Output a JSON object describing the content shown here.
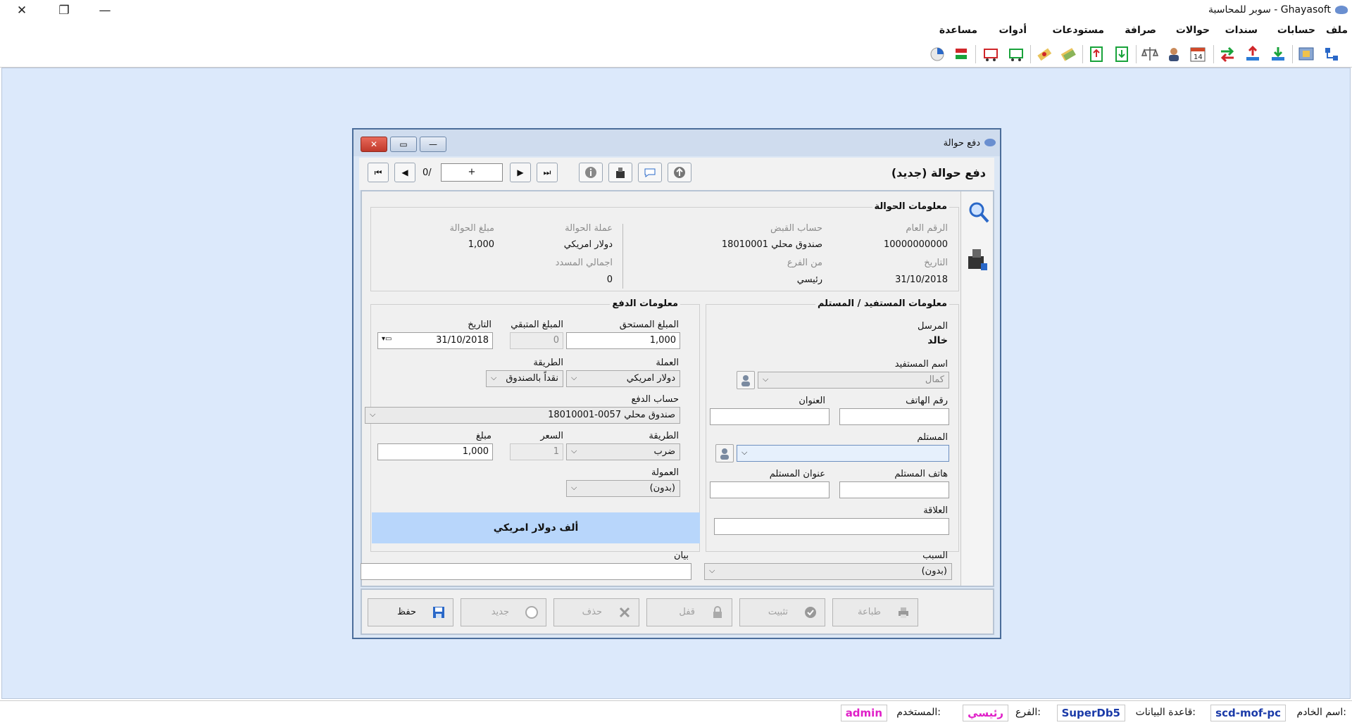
{
  "app": {
    "title": "سوبر للمحاسبة - Ghayasoft"
  },
  "titlebar": {
    "close": "✕",
    "restore": "❐",
    "minimize": "—"
  },
  "menu": [
    "ملف",
    "حسابات",
    "سندات",
    "حوالات",
    "صرافة",
    "مستودعات",
    "أدوات",
    "مساعدة"
  ],
  "status": {
    "server_label": "اسم الخادم:",
    "server": "scd-mof-pc",
    "db_label": "قاعدة البيانات:",
    "db": "SuperDb5",
    "branch_label": "الفرع:",
    "branch": "رئيسي",
    "user_label": "المستخدم:",
    "user": "admin"
  },
  "window": {
    "title": "دفع حوالة",
    "header": "دفع حوالة (جديد)",
    "close": "✕",
    "restore": "▭",
    "minimize": "—"
  },
  "nav": {
    "first": "⏮",
    "prev": "◀",
    "record": "+",
    "count": "0/",
    "next": "▶",
    "last": "⏭"
  },
  "transfer": {
    "group": "معلومات الحوالة",
    "general_no_label": "الرقم العام",
    "general_no": "10000000000",
    "date_label": "التاريخ",
    "date": "31/10/2018",
    "receipt_acc_label": "حساب القبض",
    "receipt_acc": "18010001 صندوق محلي",
    "from_branch_label": "من الفرع",
    "from_branch": "رئيسي",
    "currency_label": "عملة الحوالة",
    "currency": "دولار امريكي",
    "amount_label": "مبلغ الحوالة",
    "amount": "1,000",
    "paid_total_label": "اجمالي المسدد",
    "paid_total": "0"
  },
  "beneficiary": {
    "group": "معلومات المستفيد / المستلم",
    "sender_label": "المرسل",
    "sender": "خالد",
    "name_label": "اسم المستفيد",
    "name": "كمال",
    "phone_label": "رقم الهاتف",
    "address_label": "العنوان",
    "receiver_label": "المستلم",
    "receiver_phone_label": "هاتف المستلم",
    "receiver_address_label": "عنوان المستلم",
    "relation_label": "العلاقة"
  },
  "payment": {
    "group": "معلومات الدفع",
    "due_label": "المبلغ المستحق",
    "due": "1,000",
    "remaining_label": "المبلغ المتبقي",
    "remaining": "0",
    "date_label": "التاريخ",
    "date": "31/10/2018",
    "currency_label": "العملة",
    "currency": "دولار امريكي",
    "method_label": "الطريقة",
    "method": "نقداً بالصندوق",
    "account_label": "حساب الدفع",
    "account": "18010001-0057 صندوق محلي",
    "op_label": "الطريقة",
    "op": "ضرب",
    "rate_label": "السعر",
    "rate": "1",
    "amt_label": "مبلغ",
    "amt": "1,000",
    "commission_label": "العمولة",
    "commission": "(بدون)",
    "words": "ألف  دولار امريكي"
  },
  "reason": {
    "label": "السبب",
    "value": "(بدون)"
  },
  "note": {
    "label": "بيان"
  },
  "buttons": {
    "save": "حفظ",
    "new": "جديد",
    "delete": "حذف",
    "lock": "قفل",
    "post": "تثبيت",
    "print": "طباعة"
  },
  "colors": {
    "desk": "#dce9fb",
    "words_bg": "#b8d6fb",
    "status_user": "#e020c8",
    "status_blue": "#1a3aa8"
  }
}
